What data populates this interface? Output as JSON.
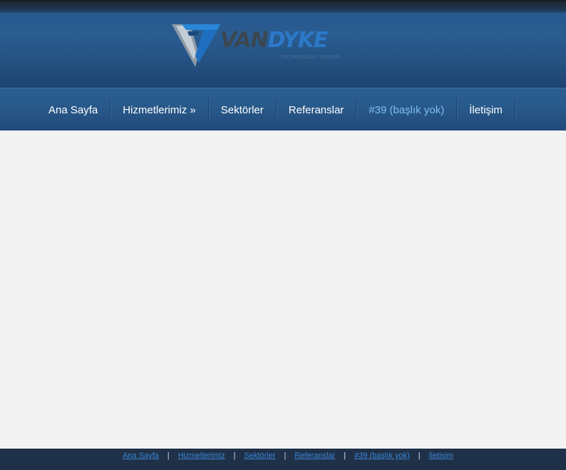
{
  "brand": {
    "name_part1": "Van",
    "name_part2": "Dyke",
    "tagline": "TECHNOLOGY GROUP"
  },
  "nav": {
    "items": [
      {
        "label": "Ana Sayfa",
        "active": false
      },
      {
        "label": "Hizmetlerimiz »",
        "active": false
      },
      {
        "label": "Sektörler",
        "active": false
      },
      {
        "label": "Referanslar",
        "active": false
      },
      {
        "label": "#39 (başlık yok)",
        "active": true
      },
      {
        "label": "İletişim",
        "active": false
      }
    ]
  },
  "footer": {
    "separator": "|",
    "links": [
      "Ana Sayfa",
      "Hizmetlerimiz",
      "Sektörler",
      "Referanslar",
      "#39 (başlık yok)",
      "İletişim"
    ]
  },
  "colors": {
    "header_blue": "#27598f",
    "nav_active": "#7fbdf2",
    "footer_bg": "#1f3148",
    "footer_link": "#3a86d6",
    "content_bg": "#f3f3f3"
  }
}
